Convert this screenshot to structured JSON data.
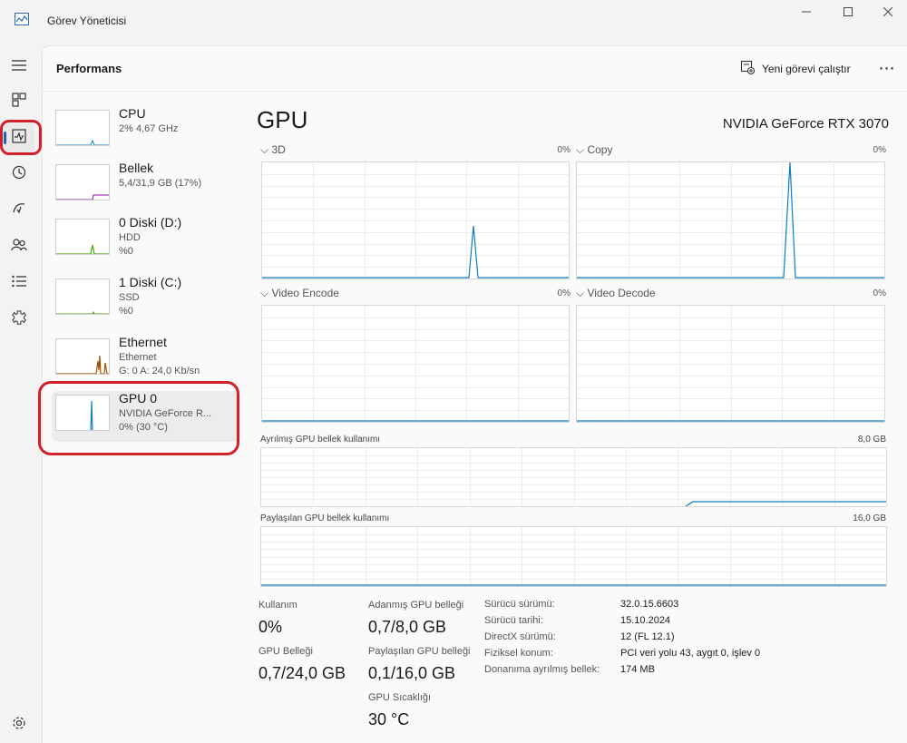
{
  "window": {
    "title": "Görev Yöneticisi",
    "controls": [
      "minimize",
      "maximize",
      "close"
    ]
  },
  "nav_rail": {
    "items": [
      {
        "icon": "hamburger-icon"
      },
      {
        "icon": "processes-icon"
      },
      {
        "icon": "performance-icon",
        "active": true
      },
      {
        "icon": "app-history-icon"
      },
      {
        "icon": "startup-apps-icon"
      },
      {
        "icon": "users-icon"
      },
      {
        "icon": "details-icon"
      },
      {
        "icon": "services-icon"
      },
      {
        "icon": "settings-icon"
      }
    ]
  },
  "header": {
    "title": "Performans",
    "run_task_label": "Yeni görevi çalıştır",
    "more_label": "⋯"
  },
  "devices": [
    {
      "name": "CPU",
      "line1": "2% 4,67 GHz",
      "line2": "",
      "color": "#117dbb"
    },
    {
      "name": "Bellek",
      "line1": "5,4/31,9 GB (17%)",
      "line2": "",
      "color": "#8b12ae"
    },
    {
      "name": "0 Diski (D:)",
      "line1": "HDD",
      "line2": "%0",
      "color": "#4da60c"
    },
    {
      "name": "1 Diski (C:)",
      "line1": "SSD",
      "line2": "%0",
      "color": "#4da60c"
    },
    {
      "name": "Ethernet",
      "line1": "Ethernet",
      "line2": "G: 0 A: 24,0 Kb/sn",
      "color": "#a74f01"
    },
    {
      "name": "GPU 0",
      "line1": "NVIDIA GeForce R...",
      "line2": "0% (30 °C)",
      "color": "#117dbb",
      "selected": true
    }
  ],
  "gpu": {
    "title": "GPU",
    "model": "NVIDIA GeForce RTX 3070",
    "engines": [
      {
        "label": "3D",
        "pct": "0%"
      },
      {
        "label": "Copy",
        "pct": "0%"
      },
      {
        "label": "Video Encode",
        "pct": "0%"
      },
      {
        "label": "Video Decode",
        "pct": "0%"
      }
    ],
    "dedicated_mem": {
      "label": "Ayrılmış GPU bellek kullanımı",
      "max": "8,0 GB"
    },
    "shared_mem": {
      "label": "Paylaşılan GPU bellek kullanımı",
      "max": "16,0 GB"
    },
    "stats": {
      "utilization_label": "Kullanım",
      "utilization_value": "0%",
      "gpu_memory_label": "GPU Belleği",
      "gpu_memory_value": "0,7/24,0 GB",
      "dedicated_label": "Adanmış GPU belleği",
      "dedicated_value": "0,7/8,0 GB",
      "shared_label": "Paylaşılan GPU belleği",
      "shared_value": "0,1/16,0 GB",
      "temp_label": "GPU Sıcaklığı",
      "temp_value": "30 °C"
    },
    "info": [
      {
        "key": "Sürücü sürümü:",
        "value": "32.0.15.6603"
      },
      {
        "key": "Sürücü tarihi:",
        "value": "15.10.2024"
      },
      {
        "key": "DirectX sürümü:",
        "value": "12 (FL 12.1)"
      },
      {
        "key": "Fiziksel konum:",
        "value": "PCI veri yolu 43, aygıt 0, işlev 0"
      },
      {
        "key": "Donanıma ayrılmış bellek:",
        "value": "174 MB"
      }
    ]
  },
  "colors": {
    "gpu_line": "#117dbb",
    "highlight": "#d0212b",
    "accent": "#1767c2"
  }
}
